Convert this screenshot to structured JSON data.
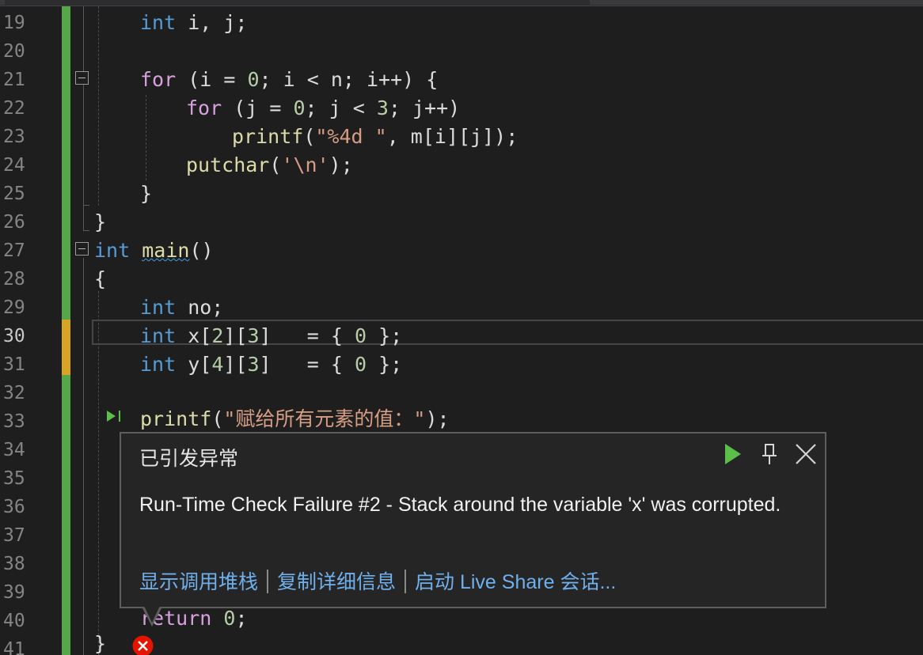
{
  "colors": {
    "change_saved": "#57a64a",
    "change_unsaved": "#d7a425",
    "link": "#6fb0ec",
    "play": "#5bbf4a",
    "error": "#e51400"
  },
  "line_numbers": [
    "19",
    "20",
    "21",
    "22",
    "23",
    "24",
    "25",
    "26",
    "27",
    "28",
    "29",
    "30",
    "31",
    "32",
    "33",
    "34",
    "35",
    "36",
    "37",
    "38",
    "39",
    "40",
    "41"
  ],
  "code": {
    "l19": {
      "kw": "int",
      "rest": " i, j;"
    },
    "l21": {
      "kw": "for",
      "p1": " (i = ",
      "n1": "0",
      "p2": "; i < n; i++) {"
    },
    "l22": {
      "kw": "for",
      "p1": " (j = ",
      "n1": "0",
      "p2": "; j < ",
      "n2": "3",
      "p3": "; j++)"
    },
    "l23": {
      "fn": "printf",
      "p1": "(",
      "str": "\"%4d \"",
      "p2": ", m[i][j]);"
    },
    "l24": {
      "fn": "putchar",
      "p1": "(",
      "str": "'\\n'",
      "p2": ");"
    },
    "l25": {
      "text": "}"
    },
    "l26": {
      "text": "}"
    },
    "l27": {
      "kw": "int",
      "sp": " ",
      "fn": "main",
      "p1": "()"
    },
    "l28": {
      "text": "{"
    },
    "l29": {
      "kw": "int",
      "rest": " no;"
    },
    "l30": {
      "kw": "int",
      "p1": " x[",
      "n1": "2",
      "p2": "][",
      "n2": "3",
      "p3": "]   = { ",
      "n3": "0",
      "p4": " };"
    },
    "l31": {
      "kw": "int",
      "p1": " y[",
      "n1": "4",
      "p2": "][",
      "n2": "3",
      "p3": "]   = { ",
      "n3": "0",
      "p4": " };"
    },
    "l33": {
      "fn": "printf",
      "p1": "(",
      "str": "\"赋给所有元素的值：\"",
      "p2": ");"
    },
    "l40": {
      "kw": "return",
      "sp": " ",
      "n1": "0",
      "p1": ";"
    },
    "l41": {
      "text": "}"
    }
  },
  "exception_popup": {
    "title": "已引发异常",
    "message": "Run-Time Check Failure #2 - Stack around the variable 'x' was corrupted.",
    "links": {
      "call_stack": "显示调用堆栈",
      "copy_details": "复制详细信息",
      "live_share": "启动 Live Share 会话..."
    },
    "icons": {
      "continue": "play-icon",
      "pin": "pin-icon",
      "close": "close-icon"
    }
  },
  "gutter_icons": {
    "run_to_click": "run-to-click-icon",
    "error": "error-icon"
  }
}
